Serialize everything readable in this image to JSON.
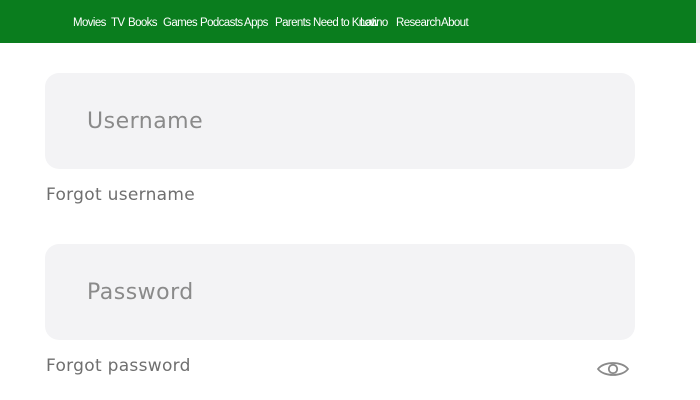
{
  "nav": {
    "items": [
      "Movies",
      "TV",
      "Books",
      "Games",
      "Podcasts",
      "Apps",
      "Parents Need to Know",
      "Latino",
      "Research",
      "About"
    ]
  },
  "login": {
    "username_placeholder": "Username",
    "username_value": "",
    "forgot_username": "Forgot username",
    "password_placeholder": "Password",
    "password_value": "",
    "forgot_password": "Forgot password",
    "toggle_icon": "eye-icon"
  },
  "colors": {
    "nav_background": "#0a7d1e",
    "nav_text": "#ffffff",
    "field_background": "#f3f3f5",
    "link_text": "#6f6f6f"
  }
}
